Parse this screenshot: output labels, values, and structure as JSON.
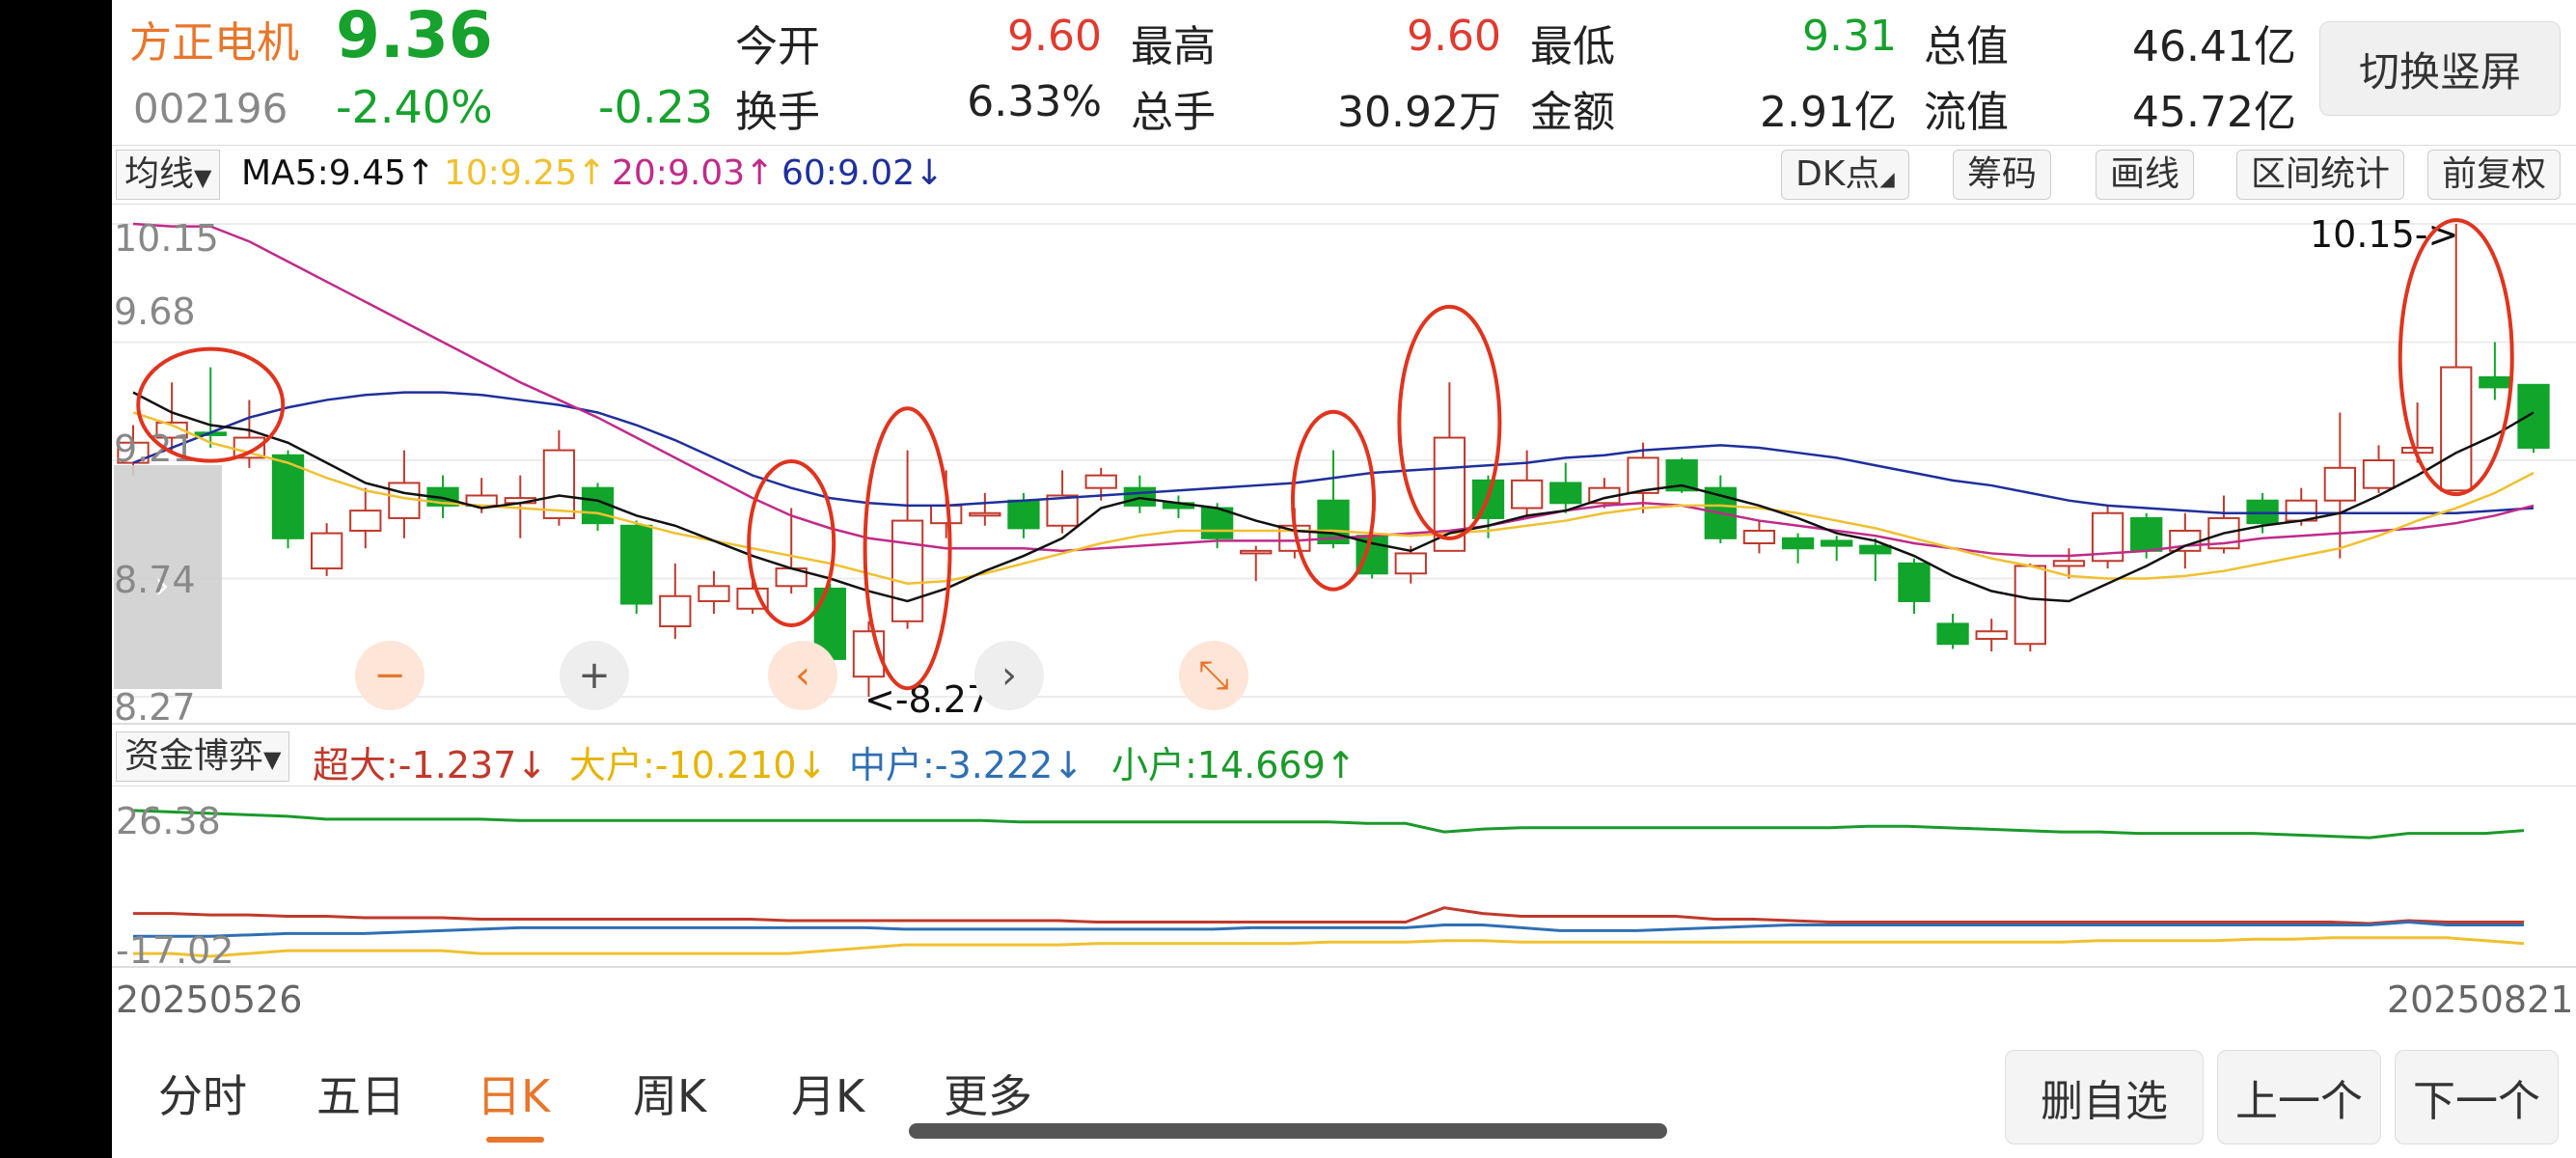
{
  "header": {
    "name": "方正电机",
    "price": "9.36",
    "code": "002196",
    "change_pct": "-2.40%",
    "change": "-0.23",
    "quotes": [
      {
        "label": "今开",
        "value": "9.60",
        "color": "red"
      },
      {
        "label": "最高",
        "value": "9.60",
        "color": "red"
      },
      {
        "label": "最低",
        "value": "9.31",
        "color": "green"
      },
      {
        "label": "总值",
        "value": "46.41亿",
        "color": "dark"
      },
      {
        "label": "换手",
        "value": "6.33%",
        "color": "dark"
      },
      {
        "label": "总手",
        "value": "30.92万",
        "color": "dark"
      },
      {
        "label": "金额",
        "value": "2.91亿",
        "color": "dark"
      },
      {
        "label": "流值",
        "value": "45.72亿",
        "color": "dark"
      }
    ],
    "switch_label": "切换竖屏"
  },
  "ma_bar": {
    "select_label": "均线",
    "ma5": "MA5:9.45↑",
    "ma10": "10:9.25↑",
    "ma20": "20:9.03↑",
    "ma60": "60:9.02↓",
    "tools": [
      "DK点",
      "筹码",
      "画线",
      "区间统计",
      "前复权"
    ]
  },
  "kline": {
    "y_ticks": [
      "10.15",
      "9.68",
      "9.21",
      "8.74",
      "8.27"
    ],
    "high_marker": "10.15->",
    "low_marker": "<-8.27",
    "colors": {
      "up": "#c0392b",
      "down": "#11a52b",
      "ma5": "#111111",
      "ma10": "#f0c030",
      "ma20": "#c02a8a",
      "ma60": "#1f2f9c",
      "annotation": "#e0341e"
    }
  },
  "chart_data": [
    {
      "type": "candlestick",
      "ylim": [
        8.27,
        10.15
      ],
      "y_ticks": [
        10.15,
        9.68,
        9.21,
        8.74,
        8.27
      ],
      "x_range": [
        "20250526",
        "20250821"
      ],
      "candles": [
        {
          "o": 9.2,
          "c": 9.28,
          "h": 9.35,
          "l": 9.15
        },
        {
          "o": 9.3,
          "c": 9.36,
          "h": 9.52,
          "l": 9.25
        },
        {
          "o": 9.32,
          "c": 9.31,
          "h": 9.58,
          "l": 9.26
        },
        {
          "o": 9.22,
          "c": 9.3,
          "h": 9.45,
          "l": 9.18
        },
        {
          "o": 9.23,
          "c": 8.9,
          "h": 9.25,
          "l": 8.86
        },
        {
          "o": 8.78,
          "c": 8.92,
          "h": 8.96,
          "l": 8.75
        },
        {
          "o": 8.93,
          "c": 9.01,
          "h": 9.1,
          "l": 8.86
        },
        {
          "o": 8.98,
          "c": 9.12,
          "h": 9.25,
          "l": 8.9
        },
        {
          "o": 9.1,
          "c": 9.03,
          "h": 9.15,
          "l": 8.98
        },
        {
          "o": 9.03,
          "c": 9.07,
          "h": 9.14,
          "l": 9.0
        },
        {
          "o": 9.04,
          "c": 9.06,
          "h": 9.15,
          "l": 8.9
        },
        {
          "o": 8.98,
          "c": 9.25,
          "h": 9.33,
          "l": 8.95
        },
        {
          "o": 9.1,
          "c": 8.96,
          "h": 9.12,
          "l": 8.93
        },
        {
          "o": 8.95,
          "c": 8.64,
          "h": 8.97,
          "l": 8.6
        },
        {
          "o": 8.55,
          "c": 8.67,
          "h": 8.8,
          "l": 8.5
        },
        {
          "o": 8.65,
          "c": 8.71,
          "h": 8.77,
          "l": 8.6
        },
        {
          "o": 8.62,
          "c": 8.7,
          "h": 8.76,
          "l": 8.6
        },
        {
          "o": 8.71,
          "c": 8.78,
          "h": 9.02,
          "l": 8.68
        },
        {
          "o": 8.7,
          "c": 8.42,
          "h": 8.72,
          "l": 8.4
        },
        {
          "o": 8.35,
          "c": 8.53,
          "h": 8.57,
          "l": 8.27
        },
        {
          "o": 8.57,
          "c": 8.97,
          "h": 9.25,
          "l": 8.54
        },
        {
          "o": 8.96,
          "c": 9.03,
          "h": 9.17,
          "l": 8.9
        },
        {
          "o": 8.99,
          "c": 9.0,
          "h": 9.08,
          "l": 8.95
        },
        {
          "o": 9.05,
          "c": 8.94,
          "h": 9.08,
          "l": 8.9
        },
        {
          "o": 8.95,
          "c": 9.07,
          "h": 9.17,
          "l": 8.92
        },
        {
          "o": 9.1,
          "c": 9.15,
          "h": 9.18,
          "l": 9.05
        },
        {
          "o": 9.1,
          "c": 9.03,
          "h": 9.15,
          "l": 9.0
        },
        {
          "o": 9.04,
          "c": 9.02,
          "h": 9.07,
          "l": 8.98
        },
        {
          "o": 9.02,
          "c": 8.9,
          "h": 9.04,
          "l": 8.86
        },
        {
          "o": 8.84,
          "c": 8.85,
          "h": 8.87,
          "l": 8.73
        },
        {
          "o": 8.85,
          "c": 8.95,
          "h": 9.02,
          "l": 8.82
        },
        {
          "o": 9.05,
          "c": 8.88,
          "h": 9.25,
          "l": 8.86
        },
        {
          "o": 8.91,
          "c": 8.76,
          "h": 8.93,
          "l": 8.74
        },
        {
          "o": 8.76,
          "c": 8.84,
          "h": 8.87,
          "l": 8.72
        },
        {
          "o": 8.85,
          "c": 9.3,
          "h": 9.52,
          "l": 8.85
        },
        {
          "o": 9.13,
          "c": 8.98,
          "h": 9.15,
          "l": 8.9
        },
        {
          "o": 9.02,
          "c": 9.13,
          "h": 9.25,
          "l": 8.98
        },
        {
          "o": 9.12,
          "c": 9.04,
          "h": 9.2,
          "l": 9.0
        },
        {
          "o": 9.04,
          "c": 9.1,
          "h": 9.14,
          "l": 9.02
        },
        {
          "o": 9.08,
          "c": 9.22,
          "h": 9.28,
          "l": 9.0
        },
        {
          "o": 9.21,
          "c": 9.09,
          "h": 9.22,
          "l": 9.08
        },
        {
          "o": 9.1,
          "c": 8.9,
          "h": 9.15,
          "l": 8.88
        },
        {
          "o": 8.88,
          "c": 8.93,
          "h": 8.97,
          "l": 8.84
        },
        {
          "o": 8.9,
          "c": 8.86,
          "h": 8.92,
          "l": 8.8
        },
        {
          "o": 8.89,
          "c": 8.87,
          "h": 8.91,
          "l": 8.81
        },
        {
          "o": 8.87,
          "c": 8.84,
          "h": 8.9,
          "l": 8.73
        },
        {
          "o": 8.8,
          "c": 8.65,
          "h": 8.82,
          "l": 8.6
        },
        {
          "o": 8.56,
          "c": 8.48,
          "h": 8.6,
          "l": 8.46
        },
        {
          "o": 8.5,
          "c": 8.53,
          "h": 8.58,
          "l": 8.45
        },
        {
          "o": 8.48,
          "c": 8.79,
          "h": 8.8,
          "l": 8.45
        },
        {
          "o": 8.79,
          "c": 8.81,
          "h": 8.86,
          "l": 8.74
        },
        {
          "o": 8.81,
          "c": 9.0,
          "h": 9.03,
          "l": 8.78
        },
        {
          "o": 8.98,
          "c": 8.85,
          "h": 9.0,
          "l": 8.82
        },
        {
          "o": 8.85,
          "c": 8.93,
          "h": 9.0,
          "l": 8.78
        },
        {
          "o": 8.86,
          "c": 8.98,
          "h": 9.07,
          "l": 8.84
        },
        {
          "o": 9.05,
          "c": 8.96,
          "h": 9.08,
          "l": 8.92
        },
        {
          "o": 8.97,
          "c": 9.05,
          "h": 9.1,
          "l": 8.95
        },
        {
          "o": 9.05,
          "c": 9.18,
          "h": 9.4,
          "l": 8.82
        },
        {
          "o": 9.1,
          "c": 9.21,
          "h": 9.27,
          "l": 9.08
        },
        {
          "o": 9.24,
          "c": 9.26,
          "h": 9.44,
          "l": 9.2
        },
        {
          "o": 9.09,
          "c": 9.58,
          "h": 10.15,
          "l": 9.09
        },
        {
          "o": 9.54,
          "c": 9.5,
          "h": 9.68,
          "l": 9.45
        },
        {
          "o": 9.51,
          "c": 9.26,
          "h": 9.51,
          "l": 9.24
        }
      ],
      "ma5": [
        9.48,
        9.4,
        9.35,
        9.33,
        9.28,
        9.2,
        9.12,
        9.08,
        9.06,
        9.02,
        9.04,
        9.07,
        9.05,
        8.99,
        8.95,
        8.89,
        8.83,
        8.78,
        8.74,
        8.69,
        8.65,
        8.7,
        8.77,
        8.83,
        8.9,
        9.02,
        9.06,
        9.04,
        9.02,
        8.97,
        8.93,
        8.92,
        8.88,
        8.85,
        8.92,
        8.95,
        8.99,
        9.01,
        9.06,
        9.09,
        9.11,
        9.07,
        9.03,
        8.98,
        8.92,
        8.89,
        8.83,
        8.75,
        8.69,
        8.66,
        8.65,
        8.72,
        8.79,
        8.87,
        8.92,
        8.95,
        8.97,
        9.0,
        9.07,
        9.15,
        9.24,
        9.31,
        9.4
      ],
      "ma10": [
        9.4,
        9.35,
        9.28,
        9.24,
        9.2,
        9.14,
        9.09,
        9.06,
        9.04,
        9.03,
        9.02,
        9.01,
        9.0,
        8.96,
        8.92,
        8.89,
        8.86,
        8.83,
        8.8,
        8.76,
        8.72,
        8.73,
        8.76,
        8.8,
        8.84,
        8.88,
        8.91,
        8.93,
        8.93,
        8.93,
        8.93,
        8.93,
        8.92,
        8.91,
        8.92,
        8.93,
        8.95,
        8.97,
        9.0,
        9.02,
        9.03,
        9.03,
        9.02,
        9.0,
        8.97,
        8.94,
        8.9,
        8.86,
        8.82,
        8.79,
        8.75,
        8.74,
        8.74,
        8.75,
        8.77,
        8.8,
        8.83,
        8.86,
        8.91,
        8.97,
        9.02,
        9.08,
        9.16
      ],
      "ma20": [
        10.15,
        10.14,
        10.14,
        10.08,
        10.0,
        9.92,
        9.84,
        9.76,
        9.68,
        9.6,
        9.52,
        9.45,
        9.38,
        9.3,
        9.22,
        9.14,
        9.06,
        8.99,
        8.94,
        8.9,
        8.88,
        8.86,
        8.86,
        8.86,
        8.85,
        8.86,
        8.87,
        8.88,
        8.89,
        8.89,
        8.89,
        8.9,
        8.91,
        8.92,
        8.93,
        8.95,
        8.98,
        9.01,
        9.03,
        9.04,
        9.03,
        9.0,
        8.97,
        8.95,
        8.93,
        8.91,
        8.88,
        8.86,
        8.84,
        8.83,
        8.83,
        8.84,
        8.85,
        8.87,
        8.88,
        8.9,
        8.91,
        8.92,
        8.93,
        8.94,
        8.96,
        8.99,
        9.03
      ],
      "ma60": [
        9.2,
        9.26,
        9.32,
        9.38,
        9.42,
        9.45,
        9.47,
        9.48,
        9.48,
        9.47,
        9.45,
        9.43,
        9.4,
        9.35,
        9.29,
        9.22,
        9.15,
        9.1,
        9.06,
        9.04,
        9.03,
        9.03,
        9.04,
        9.05,
        9.06,
        9.07,
        9.08,
        9.09,
        9.1,
        9.11,
        9.12,
        9.14,
        9.16,
        9.17,
        9.18,
        9.19,
        9.2,
        9.22,
        9.23,
        9.25,
        9.26,
        9.27,
        9.26,
        9.24,
        9.22,
        9.19,
        9.16,
        9.13,
        9.11,
        9.08,
        9.05,
        9.03,
        9.02,
        9.01,
        9.0,
        9.0,
        9.0,
        9.0,
        9.0,
        9.0,
        9.0,
        9.01,
        9.02
      ]
    },
    {
      "type": "line",
      "y_ticks": [
        26.38,
        -17.02
      ],
      "series": [
        {
          "name": "超大",
          "color": "#c0392b",
          "values": [
            -8,
            -8,
            -8.5,
            -8.5,
            -9,
            -9,
            -9.5,
            -9.5,
            -9.5,
            -10,
            -10,
            -10,
            -10,
            -10,
            -10,
            -10,
            -10,
            -10.5,
            -10.5,
            -10.5,
            -10.5,
            -10.5,
            -10.5,
            -10.5,
            -10.5,
            -11,
            -11,
            -11,
            -11,
            -11,
            -11,
            -11,
            -11,
            -11,
            -6,
            -8,
            -9,
            -9,
            -9,
            -9,
            -9,
            -10,
            -10,
            -10.5,
            -11,
            -11,
            -11,
            -11,
            -11,
            -11,
            -11,
            -11,
            -11,
            -11,
            -11,
            -11,
            -11,
            -11,
            -11.5,
            -10.5,
            -11,
            -11,
            -11
          ]
        },
        {
          "name": "大户",
          "color": "#f0c030",
          "values": [
            -22,
            -22,
            -23,
            -22,
            -21,
            -21,
            -21,
            -21,
            -21,
            -22,
            -22,
            -22,
            -22,
            -22,
            -22,
            -22,
            -22,
            -22,
            -21,
            -20,
            -19,
            -19,
            -19,
            -19,
            -19,
            -18.5,
            -18.5,
            -18.5,
            -18.5,
            -18.5,
            -18.5,
            -18,
            -18,
            -18,
            -17.5,
            -17.5,
            -18,
            -18,
            -18,
            -18,
            -18,
            -18,
            -18,
            -18,
            -18,
            -18,
            -18,
            -18,
            -18,
            -18,
            -18,
            -17.5,
            -17.5,
            -17.5,
            -17.5,
            -17,
            -17,
            -16.5,
            -16.5,
            -16.5,
            -16.5,
            -17.5,
            -18.5
          ]
        },
        {
          "name": "中户",
          "color": "#2f6fb3",
          "values": [
            -16,
            -16,
            -16,
            -15.5,
            -15,
            -15,
            -15,
            -14.5,
            -14,
            -13.5,
            -13,
            -13,
            -13,
            -13,
            -13,
            -13,
            -13,
            -13,
            -13,
            -13,
            -13.5,
            -13.5,
            -13.5,
            -13.5,
            -13.5,
            -13.5,
            -13.5,
            -13.5,
            -13.5,
            -13,
            -13,
            -13,
            -13,
            -13,
            -12,
            -12,
            -13,
            -14,
            -14,
            -14,
            -13.5,
            -13,
            -12.5,
            -12,
            -12,
            -12,
            -12,
            -12,
            -12,
            -12,
            -12,
            -12,
            -12,
            -12,
            -12,
            -12,
            -12,
            -12,
            -12,
            -11,
            -12,
            -12,
            -12
          ]
        },
        {
          "name": "小户",
          "color": "#1a9a2a",
          "values": [
            28,
            27.5,
            27,
            26.5,
            26,
            25,
            25,
            25,
            25,
            25,
            24.5,
            24.5,
            24.5,
            24.5,
            24.5,
            24.5,
            24.5,
            24.5,
            24.5,
            24.5,
            24.5,
            24.5,
            24.5,
            24,
            24,
            24,
            24,
            24,
            24,
            24,
            24,
            24,
            23.5,
            23.5,
            20.5,
            21.5,
            22,
            22,
            22,
            22,
            22,
            22,
            22,
            22,
            22,
            22.5,
            22.5,
            22,
            21.5,
            21,
            20.5,
            20.5,
            20,
            20,
            20,
            20,
            19.5,
            19,
            18.5,
            20,
            20,
            20,
            21
          ]
        }
      ]
    }
  ],
  "flow_bar": {
    "select_label": "资金博弈",
    "items": [
      {
        "text": "超大:-1.237↓",
        "color": "#c0392b"
      },
      {
        "text": "大户:-10.210↓",
        "color": "#e6b400"
      },
      {
        "text": "中户:-3.222↓",
        "color": "#2f6fb3"
      },
      {
        "text": "小户:14.669↑",
        "color": "#1a9a2a"
      }
    ],
    "y_ticks": [
      "26.38",
      "-17.02"
    ]
  },
  "dates": {
    "start": "20250526",
    "end": "20250821"
  },
  "tabs": [
    "分时",
    "五日",
    "日K",
    "周K",
    "月K",
    "更多"
  ],
  "active_tab": "日K",
  "bottom_buttons": [
    "删自选",
    "上一个",
    "下一个"
  ]
}
